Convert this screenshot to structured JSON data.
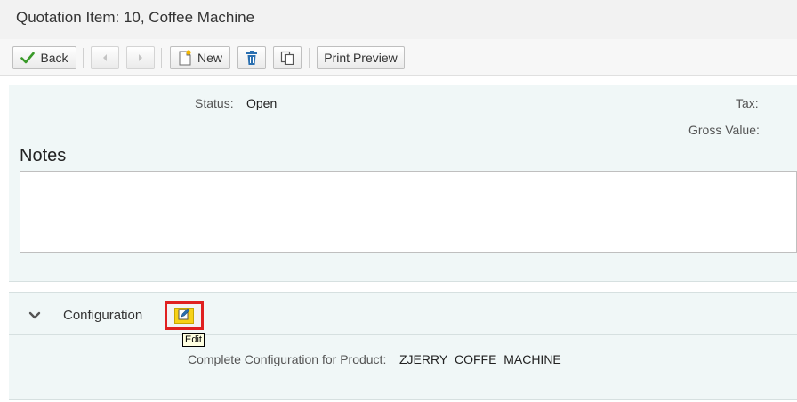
{
  "header": {
    "title": "Quotation Item: 10, Coffee Machine"
  },
  "toolbar": {
    "back_label": "Back",
    "new_label": "New",
    "print_preview_label": "Print Preview"
  },
  "details": {
    "status_label": "Status:",
    "status_value": "Open",
    "tax_label": "Tax:",
    "gross_value_label": "Gross Value:"
  },
  "notes": {
    "title": "Notes",
    "value": ""
  },
  "configuration": {
    "title": "Configuration",
    "edit_tooltip": "Edit",
    "product_label": "Complete Configuration for Product:",
    "product_value": "ZJERRY_COFFE_MACHINE"
  },
  "colors": {
    "accent_check": "#3a9a2a",
    "highlight_border": "#e02020",
    "edit_button": "#f7d117",
    "delete_icon": "#2a6fb0"
  },
  "icons": {
    "back": "checkmark-icon",
    "prev": "arrow-left-icon",
    "next": "arrow-right-icon",
    "new": "new-document-icon",
    "delete": "trash-icon",
    "copy": "copy-icon",
    "collapse": "chevron-down-icon",
    "edit": "edit-pencil-icon"
  }
}
